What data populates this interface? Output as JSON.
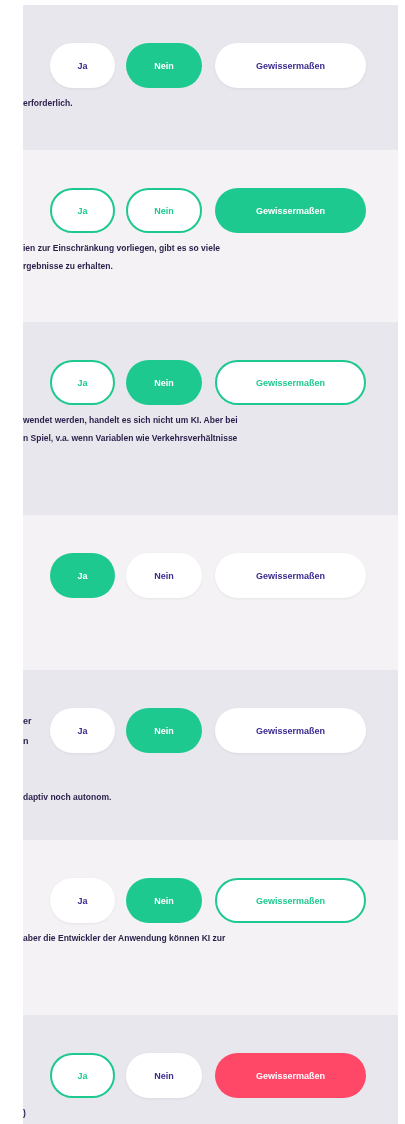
{
  "questions": [
    {
      "options": [
        {
          "label": "Ja",
          "kind": "plain"
        },
        {
          "label": "Nein",
          "kind": "filled"
        },
        {
          "label": "Gewissermaßen",
          "kind": "plain"
        }
      ],
      "explanation": [
        "erforderlich."
      ]
    },
    {
      "options": [
        {
          "label": "Ja",
          "kind": "outline"
        },
        {
          "label": "Nein",
          "kind": "outline"
        },
        {
          "label": "Gewissermaßen",
          "kind": "filled"
        }
      ],
      "explanation": [
        "ien zur Einschränkung vorliegen, gibt es so viele",
        "rgebnisse zu erhalten."
      ]
    },
    {
      "options": [
        {
          "label": "Ja",
          "kind": "outline"
        },
        {
          "label": "Nein",
          "kind": "filled"
        },
        {
          "label": "Gewissermaßen",
          "kind": "outline"
        }
      ],
      "explanation": [
        "wendet werden, handelt es sich nicht um KI. Aber bei",
        "n Spiel, v.a. wenn Variablen wie Verkehrsverhältnisse"
      ]
    },
    {
      "options": [
        {
          "label": "Ja",
          "kind": "filled"
        },
        {
          "label": "Nein",
          "kind": "plain"
        },
        {
          "label": "Gewissermaßen",
          "kind": "plain"
        }
      ]
    },
    {
      "side_text": [
        "er",
        "n"
      ],
      "options": [
        {
          "label": "Ja",
          "kind": "plain"
        },
        {
          "label": "Nein",
          "kind": "filled"
        },
        {
          "label": "Gewissermaßen",
          "kind": "plain"
        }
      ],
      "explanation": [
        "daptiv noch autonom."
      ]
    },
    {
      "options": [
        {
          "label": "Ja",
          "kind": "plain"
        },
        {
          "label": "Nein",
          "kind": "filled"
        },
        {
          "label": "Gewissermaßen",
          "kind": "outline"
        }
      ],
      "explanation": [
        "aber die Entwickler der Anwendung können KI zur"
      ]
    },
    {
      "options": [
        {
          "label": "Ja",
          "kind": "outline"
        },
        {
          "label": "Nein",
          "kind": "plain"
        },
        {
          "label": "Gewissermaßen",
          "kind": "error"
        }
      ],
      "explanation": [
        ")"
      ]
    }
  ]
}
